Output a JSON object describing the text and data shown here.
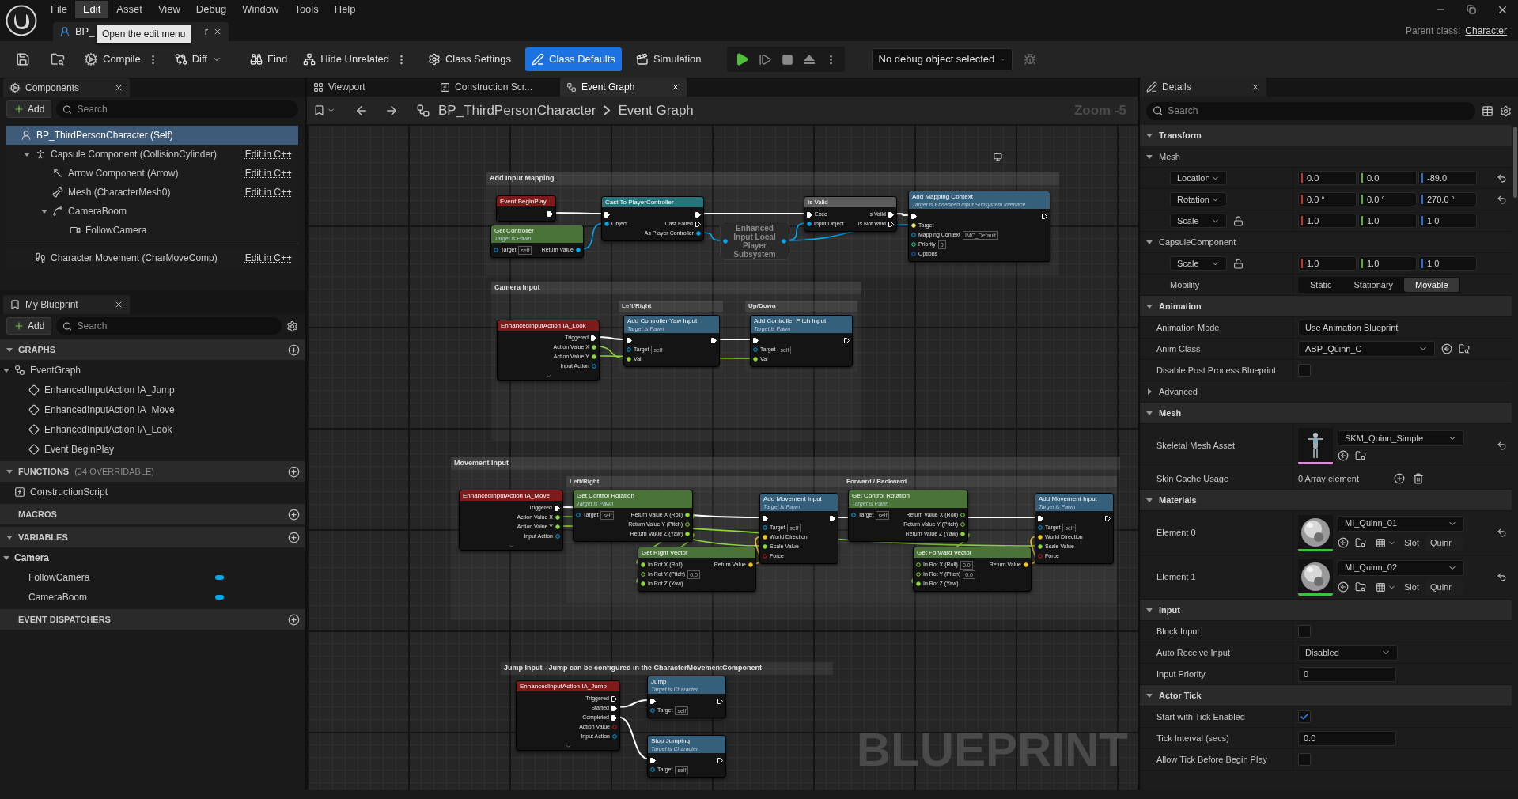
{
  "menu": [
    {
      "label": "File",
      "selected": false
    },
    {
      "label": "Edit",
      "selected": true
    },
    {
      "label": "Asset",
      "selected": false
    },
    {
      "label": "View",
      "selected": false
    },
    {
      "label": "Debug",
      "selected": false
    },
    {
      "label": "Window",
      "selected": false
    },
    {
      "label": "Tools",
      "selected": false
    },
    {
      "label": "Help",
      "selected": false
    }
  ],
  "document_tab": {
    "label_start": "BP_",
    "label_end": "r"
  },
  "tooltip": "Open the edit menu",
  "parent_class": {
    "label": "Parent class:",
    "value": "Character"
  },
  "toolbar": {
    "compile": "Compile",
    "diff": "Diff",
    "find": "Find",
    "hide_unrelated": "Hide Unrelated",
    "class_settings": "Class Settings",
    "class_defaults": {
      "label": "Class Defaults",
      "selected": true
    },
    "simulation": {
      "label": "Simulation",
      "selected": false
    },
    "debug_object": "No debug object selected"
  },
  "components": {
    "tab": "Components",
    "add": "Add",
    "search_placeholder": "Search",
    "items": [
      {
        "label": "BP_ThirdPersonCharacter (Self)",
        "kind": "self",
        "selected": true,
        "children": [
          {
            "label": "Capsule Component (CollisionCylinder)",
            "kind": "capsule",
            "selected": false,
            "expanded": true,
            "link": "Edit in C++",
            "children": [
              {
                "label": "Arrow Component (Arrow)",
                "kind": "arrow",
                "selected": false,
                "link": "Edit in C++"
              },
              {
                "label": "Mesh (CharacterMesh0)",
                "kind": "mesh",
                "selected": false,
                "link": "Edit in C++"
              },
              {
                "label": "CameraBoom",
                "kind": "boom",
                "selected": false,
                "expanded": true,
                "children": [
                  {
                    "label": "FollowCamera",
                    "kind": "camera",
                    "selected": false
                  }
                ]
              }
            ]
          },
          {
            "label": "Character Movement (CharMoveComp)",
            "kind": "movement",
            "selected": false,
            "separated": true,
            "link": "Edit in C++"
          }
        ]
      }
    ]
  },
  "my_blueprint": {
    "tab": "My Blueprint",
    "add": "Add",
    "search_placeholder": "Search",
    "sections": [
      {
        "title": "GRAPHS",
        "expanded": true,
        "items": [
          {
            "label": "EventGraph",
            "kind": "graph",
            "expanded": true,
            "children": [
              {
                "label": "EnhancedInputAction IA_Jump",
                "kind": "event"
              },
              {
                "label": "EnhancedInputAction IA_Move",
                "kind": "event"
              },
              {
                "label": "EnhancedInputAction IA_Look",
                "kind": "event"
              },
              {
                "label": "Event BeginPlay",
                "kind": "event"
              }
            ]
          }
        ]
      },
      {
        "title": "FUNCTIONS",
        "note": "(34 OVERRIDABLE)",
        "expanded": true,
        "items": [
          {
            "label": "ConstructionScript",
            "kind": "function"
          }
        ]
      },
      {
        "title": "MACROS"
      },
      {
        "title": "VARIABLES",
        "expanded": true,
        "items": [
          {
            "label": "Camera",
            "kind": "category",
            "expanded": true,
            "children": [
              {
                "label": "FollowCamera",
                "kind": "variable"
              },
              {
                "label": "CameraBoom",
                "kind": "variable"
              }
            ]
          }
        ]
      },
      {
        "title": "EVENT DISPATCHERS"
      }
    ]
  },
  "graph_tabs": [
    {
      "label": "Viewport",
      "kind": "viewport",
      "selected": false
    },
    {
      "label": "Construction Scr...",
      "kind": "function",
      "selected": false
    },
    {
      "label": "Event Graph",
      "kind": "graph",
      "selected": true
    }
  ],
  "breadcrumb": [
    "BP_ThirdPersonCharacter",
    "Event Graph"
  ],
  "zoom": "Zoom -5",
  "graph_label": "BLUEPRINT",
  "comments": [
    {
      "title": "Add Input Mapping",
      "kind": "group"
    },
    {
      "title": "Camera Input",
      "kind": "group"
    },
    {
      "title": "Left/Right",
      "kind": "sub"
    },
    {
      "title": "Up/Down",
      "kind": "sub"
    },
    {
      "title": "Movement Input",
      "kind": "group"
    },
    {
      "title": "Left/Right",
      "kind": "sub"
    },
    {
      "title": "Forward / Backward",
      "kind": "sub"
    },
    {
      "title": "Jump Input - Jump can be configured in the CharacterMovementComponent",
      "kind": "header"
    }
  ],
  "nodes": [
    {
      "kind": "event",
      "title": "Event BeginPlay",
      "outputs": [
        {
          "kind": "exec",
          "linked": true
        }
      ]
    },
    {
      "kind": "pure",
      "title": "Get Controller",
      "subtitle": "Target is Pawn",
      "inputs": [
        {
          "label": "Target",
          "kind": "object",
          "default": "self",
          "linked": false
        }
      ],
      "outputs": [
        {
          "label": "Return Value",
          "kind": "object",
          "linked": true
        }
      ]
    },
    {
      "kind": "cast",
      "title": "Cast To PlayerController",
      "inputs": [
        {
          "kind": "exec",
          "linked": true
        },
        {
          "label": "Object",
          "kind": "object",
          "linked": true
        }
      ],
      "outputs": [
        {
          "kind": "exec",
          "linked": true
        },
        {
          "label": "Cast Failed",
          "kind": "exec",
          "linked": false
        },
        {
          "label": "As Player Controller",
          "kind": "object",
          "linked": true
        }
      ]
    },
    {
      "kind": "compact",
      "title": "Enhanced Input Local Player Subsystem",
      "inputs": [
        {
          "kind": "object",
          "linked": true
        }
      ],
      "outputs": [
        {
          "kind": "object",
          "linked": true
        }
      ]
    },
    {
      "kind": "macro",
      "title": "Is Valid",
      "inputs": [
        {
          "label": "Exec",
          "kind": "exec",
          "linked": true
        },
        {
          "label": "Input Object",
          "kind": "object",
          "linked": true
        }
      ],
      "outputs": [
        {
          "label": "Is Valid",
          "kind": "exec",
          "linked": true
        },
        {
          "label": "Is Not Valid",
          "kind": "exec",
          "linked": false
        }
      ]
    },
    {
      "kind": "function",
      "title": "Add Mapping Context",
      "subtitle": "Target is Enhanced Input Subsystem Interface",
      "inputs": [
        {
          "kind": "exec",
          "linked": true
        },
        {
          "label": "Target",
          "kind": "interface",
          "linked": true
        },
        {
          "label": "Mapping Context",
          "kind": "object",
          "default": "IMC_Default",
          "linked": false
        },
        {
          "label": "Priority",
          "kind": "int",
          "default": "0",
          "linked": false
        },
        {
          "label": "Options",
          "kind": "struct",
          "linked": false
        }
      ],
      "outputs": [
        {
          "kind": "exec",
          "linked": false
        }
      ]
    },
    {
      "kind": "event",
      "title": "EnhancedInputAction IA_Look",
      "expandable": true,
      "outputs": [
        {
          "label": "Triggered",
          "kind": "exec",
          "linked": true
        },
        {
          "label": "Action Value X",
          "kind": "float",
          "linked": true
        },
        {
          "label": "Action Value Y",
          "kind": "float",
          "linked": true
        },
        {
          "label": "Input Action",
          "kind": "object",
          "linked": false
        }
      ]
    },
    {
      "kind": "function",
      "title": "Add Controller Yaw Input",
      "subtitle": "Target is Pawn",
      "inputs": [
        {
          "kind": "exec",
          "linked": true
        },
        {
          "label": "Target",
          "kind": "object",
          "default": "self",
          "linked": false
        },
        {
          "label": "Val",
          "kind": "float",
          "linked": true
        }
      ],
      "outputs": [
        {
          "kind": "exec",
          "linked": true
        }
      ]
    },
    {
      "kind": "function",
      "title": "Add Controller Pitch Input",
      "subtitle": "Target is Pawn",
      "inputs": [
        {
          "kind": "exec",
          "linked": true
        },
        {
          "label": "Target",
          "kind": "object",
          "default": "self",
          "linked": false
        },
        {
          "label": "Val",
          "kind": "float",
          "linked": true
        }
      ],
      "outputs": [
        {
          "kind": "exec",
          "linked": false
        }
      ]
    },
    {
      "kind": "event",
      "title": "EnhancedInputAction IA_Move",
      "expandable": true,
      "outputs": [
        {
          "label": "Triggered",
          "kind": "exec",
          "linked": true
        },
        {
          "label": "Action Value X",
          "kind": "float",
          "linked": true
        },
        {
          "label": "Action Value Y",
          "kind": "float",
          "linked": true
        },
        {
          "label": "Input Action",
          "kind": "object",
          "linked": false
        }
      ]
    },
    {
      "kind": "pure",
      "title": "Get Control Rotation",
      "subtitle": "Target is Pawn",
      "inputs": [
        {
          "label": "Target",
          "kind": "object",
          "default": "self",
          "linked": false
        }
      ],
      "outputs": [
        {
          "label": "Return Value X (Roll)",
          "kind": "float",
          "linked": true
        },
        {
          "label": "Return Value Y (Pitch)",
          "kind": "float",
          "linked": false
        },
        {
          "label": "Return Value Z (Yaw)",
          "kind": "float",
          "linked": true
        }
      ]
    },
    {
      "kind": "pure",
      "title": "Get Right Vector",
      "inputs": [
        {
          "label": "In Rot X (Roll)",
          "kind": "float",
          "linked": true
        },
        {
          "label": "In Rot Y (Pitch)",
          "kind": "float",
          "default": "0.0",
          "linked": false
        },
        {
          "label": "In Rot Z (Yaw)",
          "kind": "float",
          "linked": true
        }
      ],
      "outputs": [
        {
          "label": "Return Value",
          "kind": "vector",
          "linked": true
        }
      ]
    },
    {
      "kind": "function",
      "title": "Add Movement Input",
      "subtitle": "Target is Pawn",
      "inputs": [
        {
          "kind": "exec",
          "linked": true
        },
        {
          "label": "Target",
          "kind": "object",
          "default": "self",
          "linked": false
        },
        {
          "label": "World Direction",
          "kind": "vector",
          "linked": true
        },
        {
          "label": "Scale Value",
          "kind": "float",
          "linked": true
        },
        {
          "label": "Force",
          "kind": "bool",
          "linked": false
        }
      ],
      "outputs": [
        {
          "kind": "exec",
          "linked": true
        }
      ]
    },
    {
      "kind": "pure",
      "title": "Get Control Rotation",
      "subtitle": "Target is Pawn",
      "inputs": [
        {
          "label": "Target",
          "kind": "object",
          "default": "self",
          "linked": false
        }
      ],
      "outputs": [
        {
          "label": "Return Value X (Roll)",
          "kind": "float",
          "linked": false
        },
        {
          "label": "Return Value Y (Pitch)",
          "kind": "float",
          "linked": false
        },
        {
          "label": "Return Value Z (Yaw)",
          "kind": "float",
          "linked": true
        }
      ]
    },
    {
      "kind": "pure",
      "title": "Get Forward Vector",
      "inputs": [
        {
          "label": "In Rot X (Roll)",
          "kind": "float",
          "default": "0.0",
          "linked": false
        },
        {
          "label": "In Rot Y (Pitch)",
          "kind": "float",
          "default": "0.0",
          "linked": false
        },
        {
          "label": "In Rot Z (Yaw)",
          "kind": "float",
          "linked": true
        }
      ],
      "outputs": [
        {
          "label": "Return Value",
          "kind": "vector",
          "linked": true
        }
      ]
    },
    {
      "kind": "function",
      "title": "Add Movement Input",
      "subtitle": "Target is Pawn",
      "inputs": [
        {
          "kind": "exec",
          "linked": true
        },
        {
          "label": "Target",
          "kind": "object",
          "default": "self",
          "linked": false
        },
        {
          "label": "World Direction",
          "kind": "vector",
          "linked": true
        },
        {
          "label": "Scale Value",
          "kind": "float",
          "linked": true
        },
        {
          "label": "Force",
          "kind": "bool",
          "linked": false
        }
      ],
      "outputs": [
        {
          "kind": "exec",
          "linked": false
        }
      ]
    },
    {
      "kind": "event",
      "title": "EnhancedInputAction IA_Jump",
      "expandable": true,
      "outputs": [
        {
          "label": "Triggered",
          "kind": "exec",
          "linked": false
        },
        {
          "label": "Started",
          "kind": "exec",
          "linked": true
        },
        {
          "label": "Completed",
          "kind": "exec",
          "linked": true
        },
        {
          "label": "Action Value",
          "kind": "bool",
          "linked": false
        },
        {
          "label": "Input Action",
          "kind": "object",
          "linked": false
        }
      ]
    },
    {
      "kind": "function",
      "title": "Jump",
      "subtitle": "Target is Character",
      "inputs": [
        {
          "kind": "exec",
          "linked": true
        },
        {
          "label": "Target",
          "kind": "object",
          "default": "self",
          "linked": false
        }
      ],
      "outputs": [
        {
          "kind": "exec",
          "linked": false
        }
      ]
    },
    {
      "kind": "function",
      "title": "Stop Jumping",
      "subtitle": "Target is Character",
      "inputs": [
        {
          "kind": "exec",
          "linked": true
        },
        {
          "label": "Target",
          "kind": "object",
          "default": "self",
          "linked": false
        }
      ],
      "outputs": [
        {
          "kind": "exec",
          "linked": false
        }
      ]
    }
  ],
  "details": {
    "tab": "Details",
    "search_placeholder": "Search",
    "rows": [
      {
        "kind": "category",
        "label": "Transform",
        "expanded": true
      },
      {
        "kind": "subcategory",
        "label": "Mesh",
        "expanded": true
      },
      {
        "kind": "vector",
        "label": "Location",
        "values": [
          "0.0",
          "0.0",
          "-89.0"
        ],
        "modified": true
      },
      {
        "kind": "vector",
        "label": "Rotation",
        "values": [
          "0.0 °",
          "0.0 °",
          "270.0 °"
        ],
        "modified": true
      },
      {
        "kind": "vector",
        "label": "Scale",
        "locked": false,
        "values": [
          "1.0",
          "1.0",
          "1.0"
        ],
        "modified": false
      },
      {
        "kind": "subcategory",
        "label": "CapsuleComponent",
        "expanded": true
      },
      {
        "kind": "vector",
        "label": "Scale",
        "locked": false,
        "values": [
          "1.0",
          "1.0",
          "1.0"
        ],
        "modified": false
      },
      {
        "kind": "segmented",
        "label": "Mobility",
        "options": [
          {
            "label": "Static",
            "selected": false
          },
          {
            "label": "Stationary",
            "selected": false
          },
          {
            "label": "Movable",
            "selected": true
          }
        ]
      },
      {
        "kind": "category",
        "label": "Animation",
        "expanded": true
      },
      {
        "kind": "dropdown",
        "label": "Animation Mode",
        "value": "Use Animation Blueprint"
      },
      {
        "kind": "class",
        "label": "Anim Class",
        "value": "ABP_Quinn_C"
      },
      {
        "kind": "checkbox",
        "label": "Disable Post Process Blueprint",
        "checked": false
      },
      {
        "kind": "subcategory",
        "label": "Advanced",
        "expanded": false
      },
      {
        "kind": "category",
        "label": "Mesh",
        "expanded": true
      },
      {
        "kind": "asset",
        "label": "Skeletal Mesh Asset",
        "value": "SKM_Quinn_Simple",
        "modified": true
      },
      {
        "kind": "array",
        "label": "Skin Cache Usage",
        "value": "0 Array element"
      },
      {
        "kind": "category",
        "label": "Materials",
        "expanded": true
      },
      {
        "kind": "material",
        "label": "Element 0",
        "value": "MI_Quinn_01",
        "slot_label": "Slot",
        "slot": "Quinr",
        "modified": true
      },
      {
        "kind": "material",
        "label": "Element 1",
        "value": "MI_Quinn_02",
        "slot_label": "Slot",
        "slot": "Quinr",
        "modified": true
      },
      {
        "kind": "category",
        "label": "Input",
        "expanded": true
      },
      {
        "kind": "checkbox",
        "label": "Block Input",
        "checked": false
      },
      {
        "kind": "dropdown",
        "label": "Auto Receive Input",
        "value": "Disabled"
      },
      {
        "kind": "number",
        "label": "Input Priority",
        "value": "0"
      },
      {
        "kind": "category",
        "label": "Actor Tick",
        "expanded": true
      },
      {
        "kind": "checkbox",
        "label": "Start with Tick Enabled",
        "checked": true
      },
      {
        "kind": "number",
        "label": "Tick Interval (secs)",
        "value": "0.0"
      },
      {
        "kind": "checkbox",
        "label": "Allow Tick Before Begin Play",
        "checked": false
      }
    ]
  }
}
